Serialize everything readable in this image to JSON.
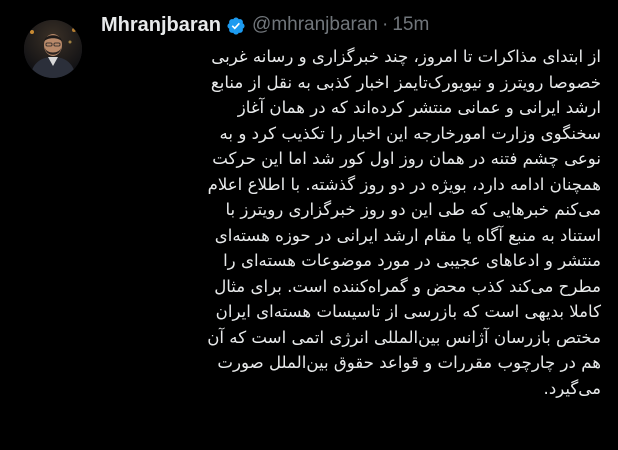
{
  "tweet": {
    "author": {
      "display_name": "Mhranjbaran",
      "handle": "@mhranjbaran",
      "verified": true,
      "avatar_icon": "profile-photo"
    },
    "separator": "·",
    "timestamp": "15m",
    "text_lines": [
      "از ابتدای مذاکرات تا امروز، چند خبرگزاری و رسانه غربی",
      "خصوصا رویترز و نیویورک‌تایمز اخبار کذبی به نقل از منابع",
      "ارشد ایرانی و عمانی منتشر کرده‌اند که در همان آغاز",
      "سخنگوی وزارت امورخارجه این اخبار را تکذیب کرد و به",
      "نوعی چشم فتنه در همان روز اول کور شد اما این حرکت",
      "همچنان ادامه دارد، بویژه در دو روز گذشته. با اطلاع اعلام",
      "می‌کنم خبرهایی که طی این دو روز خبرگزاری رویترز با",
      "استناد به منبع آگاه یا مقام ارشد ایرانی در حوزه هسته‌ای",
      "منتشر و ادعاهای عجیبی در مورد موضوعات هسته‌ای را",
      "مطرح می‌کند کذب محض و گمراه‌کننده است. برای مثال",
      "کاملا بدیهی است که بازرسی از تاسیسات هسته‌ای ایران",
      "مختص بازرسان آژانس بین‌المللی انرژی اتمی است که آن",
      "هم در چارچوب مقررات و قواعد حقوق بین‌الملل صورت",
      "می‌گیرد."
    ]
  },
  "colors": {
    "background": "#000000",
    "text": "#e7e9ea",
    "secondary_text": "#71767b",
    "verified_badge": "#1d9bf0"
  }
}
